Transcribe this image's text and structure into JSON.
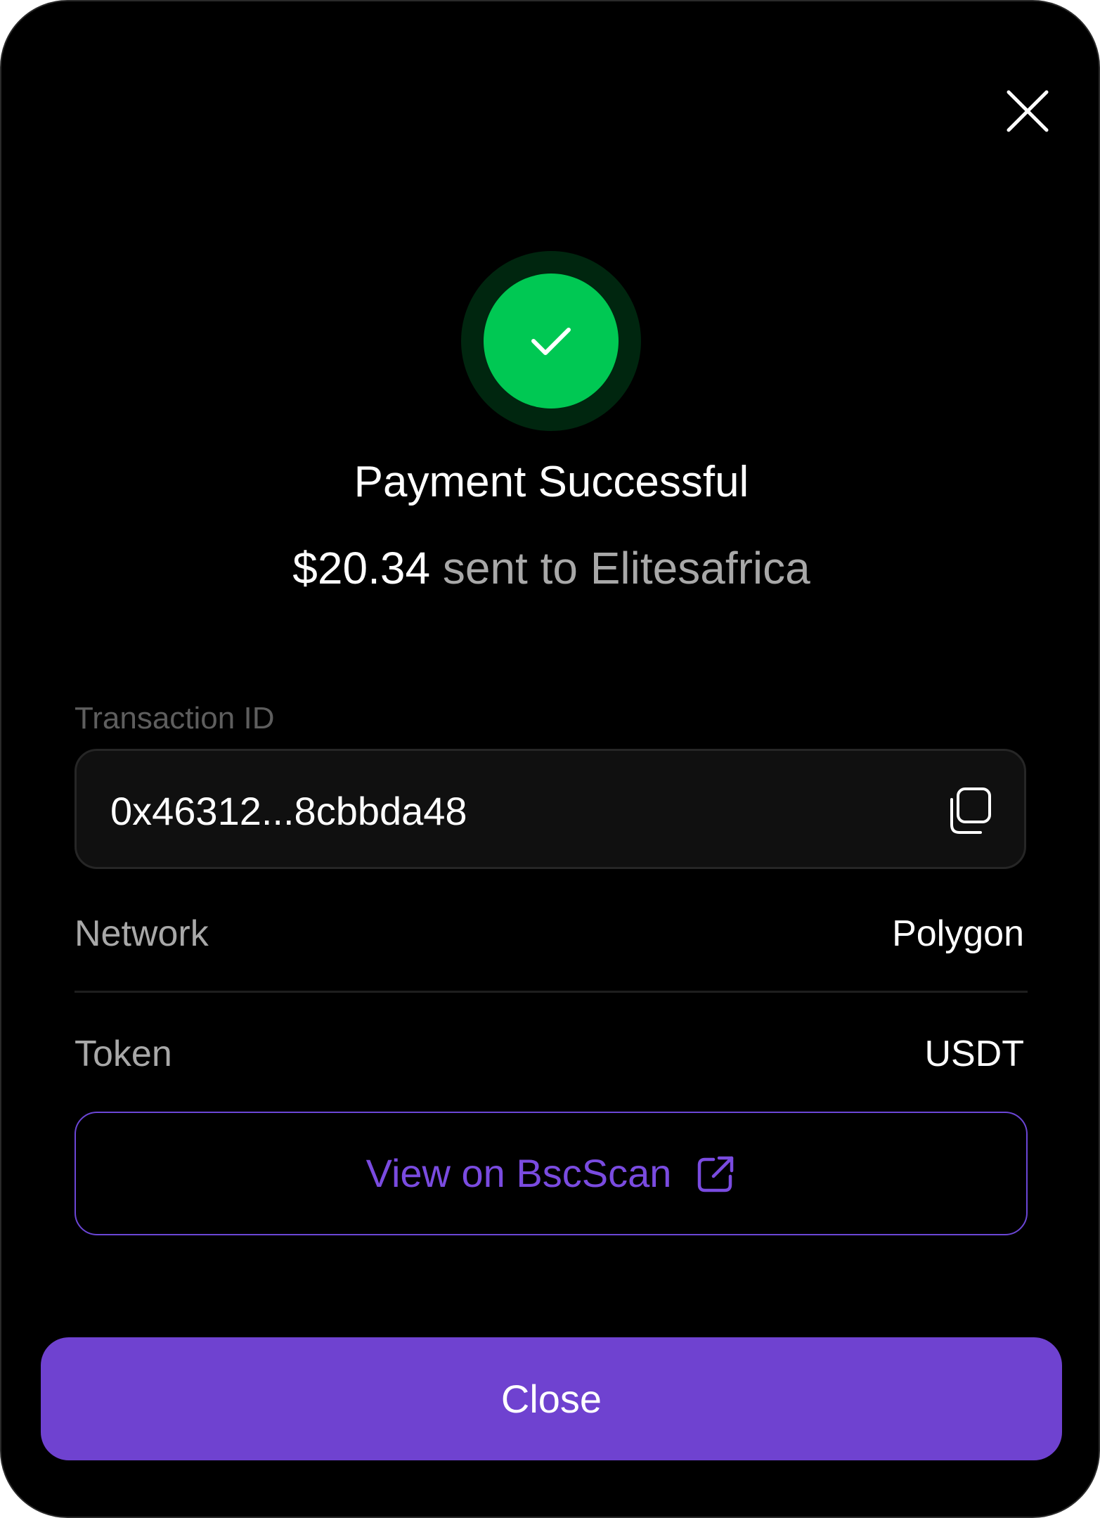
{
  "modal": {
    "title": "Payment Successful",
    "amount": "$20.34",
    "recipient_text": " sent to Elitesafrica"
  },
  "transaction": {
    "label": "Transaction ID",
    "value": "0x46312...8cbbda48"
  },
  "details": [
    {
      "label": "Network",
      "value": "Polygon"
    },
    {
      "label": "Token",
      "value": "USDT"
    }
  ],
  "actions": {
    "explorer_label": "View on BscScan",
    "close_label": "Close"
  },
  "icons": {
    "close": "close-icon",
    "success": "checkmark-icon",
    "copy": "copy-icon",
    "external": "external-link-icon"
  },
  "colors": {
    "background": "#000000",
    "success": "#00c853",
    "accent": "#6f42d0"
  }
}
